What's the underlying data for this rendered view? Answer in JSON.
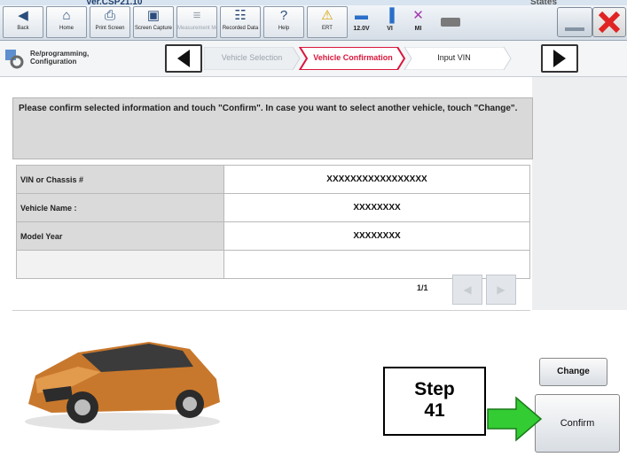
{
  "window": {
    "version": "Ver.CSP21.10",
    "right_text": "States"
  },
  "toolbar": [
    {
      "label": "Back",
      "icon": "back-icon",
      "glyph": "◀",
      "enabled": true
    },
    {
      "label": "Home",
      "icon": "home-icon",
      "glyph": "⌂",
      "enabled": true
    },
    {
      "label": "Print Screen",
      "icon": "printer-icon",
      "glyph": "⎙",
      "enabled": true
    },
    {
      "label": "Screen Capture",
      "icon": "camera-icon",
      "glyph": "▣",
      "enabled": true
    },
    {
      "label": "Measurement Mode",
      "icon": "measurement-icon",
      "glyph": "≡",
      "enabled": false
    },
    {
      "label": "Recorded Data",
      "icon": "recorded-data-icon",
      "glyph": "☷",
      "enabled": true
    },
    {
      "label": "Help",
      "icon": "help-icon",
      "glyph": "?",
      "enabled": true
    },
    {
      "label": "ERT",
      "icon": "warning-icon",
      "glyph": "⚠",
      "enabled": true
    }
  ],
  "status": [
    {
      "label": "12.0V",
      "icon": "car-battery-icon",
      "glyph": "▬",
      "color": "#2a6fc9"
    },
    {
      "label": "VI",
      "icon": "signal-icon",
      "glyph": "▐",
      "color": "#2a6fc9"
    },
    {
      "label": "MI",
      "icon": "x-mark-icon",
      "glyph": "✕",
      "color": "#a23bb0"
    }
  ],
  "crumbs": {
    "first": "Re/programming, Configuration",
    "items": [
      {
        "label": "Vehicle Selection",
        "state": "past"
      },
      {
        "label": "Vehicle Confirmation",
        "state": "current"
      },
      {
        "label": "Input VIN",
        "state": "next"
      }
    ]
  },
  "message": "Please confirm selected information and touch \"Confirm\". In case you want to select another vehicle, touch \"Change\".",
  "rows": [
    {
      "label": "VIN or Chassis #",
      "value": "XXXXXXXXXXXXXXXXX"
    },
    {
      "label": "Vehicle Name :",
      "value": "XXXXXXXX"
    },
    {
      "label": "Model Year",
      "value": "XXXXXXXX"
    }
  ],
  "pager": "1/1",
  "buttons": {
    "change": "Change",
    "confirm": "Confirm"
  },
  "annotation": {
    "line1": "Step",
    "line2": "41"
  },
  "colors": {
    "accent_red": "#d9163b",
    "arrow_green": "#33cc33",
    "close_red": "#e02323"
  }
}
